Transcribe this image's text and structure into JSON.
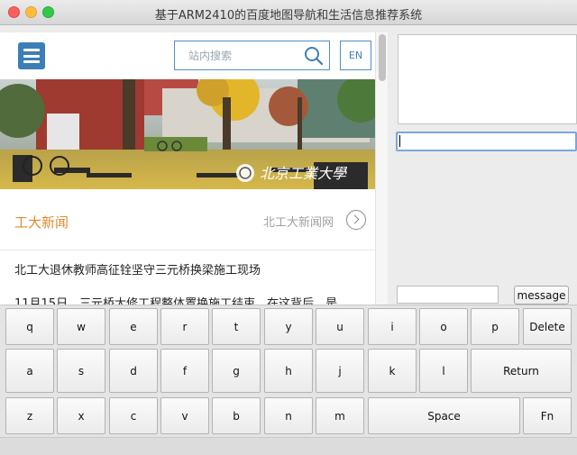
{
  "window": {
    "title": "基于ARM2410的百度地图导航和生活信息推荐系统"
  },
  "web": {
    "search_placeholder": "站内搜索",
    "lang_button": "EN",
    "section_title": "工大新闻",
    "section_link": "北工大新闻网",
    "news": [
      "北工大退休教师高征铨坚守三元桥换梁施工现场",
      "11月15日，三元桥大修工程整体置换施工结束。在这背后，是"
    ],
    "banner_logo_text": "北京工業大學"
  },
  "panel": {
    "message_button": "message"
  },
  "keyboard": {
    "row1": [
      "q",
      "w",
      "e",
      "r",
      "t",
      "y",
      "u",
      "i",
      "o",
      "p",
      "Delete"
    ],
    "row2": [
      "a",
      "s",
      "d",
      "f",
      "g",
      "h",
      "j",
      "k",
      "l",
      "Return"
    ],
    "row3": [
      "z",
      "x",
      "c",
      "v",
      "b",
      "n",
      "m",
      "Space",
      "Fn"
    ]
  },
  "colors": {
    "accent_blue": "#3b7fb6",
    "section_orange": "#e08a2e"
  }
}
